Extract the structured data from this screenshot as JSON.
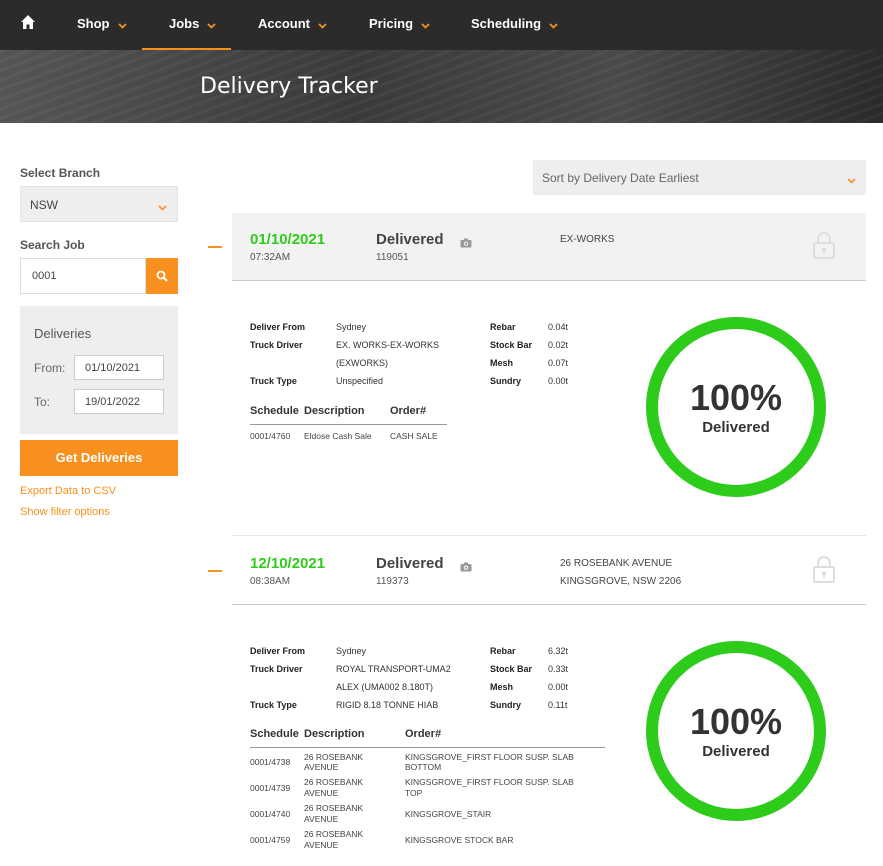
{
  "nav": {
    "items": [
      {
        "label": "Shop"
      },
      {
        "label": "Jobs"
      },
      {
        "label": "Account"
      },
      {
        "label": "Pricing"
      },
      {
        "label": "Scheduling"
      }
    ]
  },
  "hero": {
    "title": "Delivery Tracker"
  },
  "sidebar": {
    "branch_label": "Select Branch",
    "branch_value": "NSW",
    "search_label": "Search Job",
    "search_value": "0001",
    "deliveries_title": "Deliveries",
    "from_label": "From:",
    "from_value": "01/10/2021",
    "to_label": "To:",
    "to_value": "19/01/2022",
    "get_button": "Get Deliveries",
    "export_link": "Export Data to CSV",
    "filter_link": "Show filter options"
  },
  "sort": {
    "value": "Sort by Delivery Date Earliest"
  },
  "colors": {
    "accent": "#f7901e",
    "green": "#2ecc1a",
    "nav_bg": "#2b2b2b"
  },
  "cards": [
    {
      "date": "01/10/2021",
      "time": "07:32AM",
      "status": "Delivered",
      "number": "119051",
      "address_line1": "EX-WORKS",
      "address_line2": "",
      "deliver_from_label": "Deliver From",
      "deliver_from": "Sydney",
      "truck_driver_label": "Truck Driver",
      "truck_driver_1": "EX. WORKS-EX-WORKS",
      "truck_driver_2": "(EXWORKS)",
      "truck_type_label": "Truck Type",
      "truck_type": "Unspecified",
      "weights": [
        {
          "label": "Rebar",
          "value": "0.04t"
        },
        {
          "label": "Stock Bar",
          "value": "0.02t"
        },
        {
          "label": "Mesh",
          "value": "0.07t"
        },
        {
          "label": "Sundry",
          "value": "0.00t"
        }
      ],
      "table_headers": [
        "Schedule",
        "Description",
        "Order#"
      ],
      "rows": [
        {
          "schedule": "0001/4760",
          "description": "Eldose Cash Sale",
          "order": "CASH SALE"
        }
      ],
      "percent": "100%",
      "percent_label": "Delivered",
      "progress": 1.0
    },
    {
      "date": "12/10/2021",
      "time": "08:38AM",
      "status": "Delivered",
      "number": "119373",
      "address_line1": "26 ROSEBANK AVENUE",
      "address_line2": "KINGSGROVE, NSW 2206",
      "deliver_from_label": "Deliver From",
      "deliver_from": "Sydney",
      "truck_driver_label": "Truck Driver",
      "truck_driver_1": "ROYAL TRANSPORT-UMA2",
      "truck_driver_2": "ALEX (UMA002 8.180T)",
      "truck_type_label": "Truck Type",
      "truck_type": "RIGID 8.18 TONNE HIAB",
      "weights": [
        {
          "label": "Rebar",
          "value": "6.32t"
        },
        {
          "label": "Stock Bar",
          "value": "0.33t"
        },
        {
          "label": "Mesh",
          "value": "0.00t"
        },
        {
          "label": "Sundry",
          "value": "0.11t"
        }
      ],
      "table_headers": [
        "Schedule",
        "Description",
        "Order#"
      ],
      "rows": [
        {
          "schedule": "0001/4738",
          "description_1": "26 ROSEBANK",
          "description_2": "AVENUE",
          "order_1": "KINGSGROVE_FIRST FLOOR SUSP. SLAB",
          "order_2": "BOTTOM"
        },
        {
          "schedule": "0001/4739",
          "description_1": "26 ROSEBANK",
          "description_2": "AVENUE",
          "order_1": "KINGSGROVE_FIRST FLOOR SUSP. SLAB",
          "order_2": "TOP"
        },
        {
          "schedule": "0001/4740",
          "description_1": "26 ROSEBANK",
          "description_2": "AVENUE",
          "order_1": "KINGSGROVE_STAIR",
          "order_2": ""
        },
        {
          "schedule": "0001/4759",
          "description_1": "26 ROSEBANK",
          "description_2": "AVENUE",
          "order_1": "KINGSGROVE STOCK BAR",
          "order_2": ""
        }
      ],
      "percent": "100%",
      "percent_label": "Delivered",
      "progress": 1.0
    }
  ]
}
